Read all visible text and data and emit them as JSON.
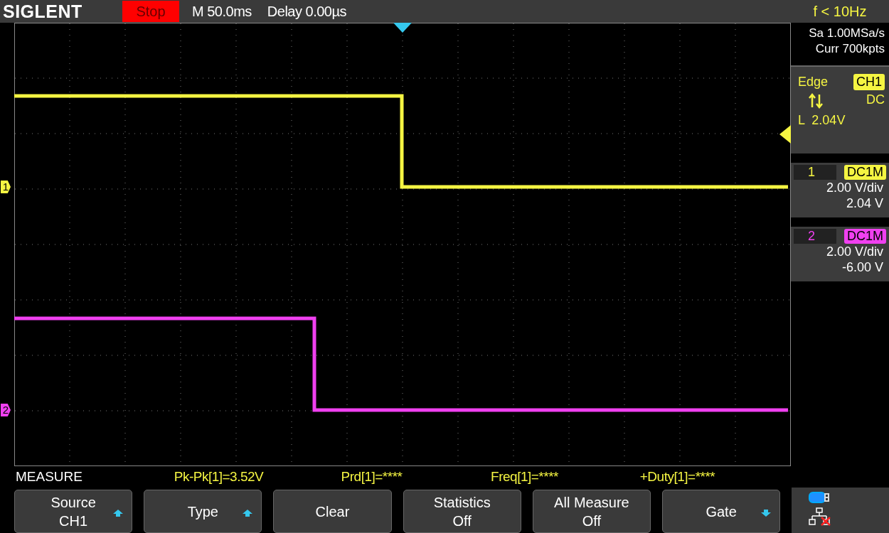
{
  "header": {
    "logo": "SIGLENT",
    "run_state": "Stop",
    "timebase": "M 50.0ms",
    "delay": "Delay 0.00µs",
    "frequency": "f < 10Hz"
  },
  "acquisition": {
    "sample_rate": "Sa 1.00MSa/s",
    "memory": "Curr 700kpts"
  },
  "trigger": {
    "type": "Edge",
    "source": "CH1",
    "coupling": "DC",
    "level": "L  2.04V"
  },
  "channels": [
    {
      "marker": "1",
      "number": "1",
      "coupling": "DC1M",
      "scale": "2.00 V/div",
      "offset": "2.04 V",
      "color": "#f5f542"
    },
    {
      "marker": "2",
      "number": "2",
      "coupling": "DC1M",
      "scale": "2.00 V/div",
      "offset": "-6.00 V",
      "color": "#f040f0"
    }
  ],
  "measure": {
    "title": "MEASURE",
    "readings": [
      "Pk-Pk[1]=3.52V",
      "Prd[1]=****",
      "Freq[1]=****",
      "+Duty[1]=****"
    ]
  },
  "softkeys": [
    {
      "kind": "uparrow",
      "label": "Source",
      "value": "CH1"
    },
    {
      "kind": "uparrow",
      "label": "Type"
    },
    {
      "kind": "plain",
      "label": "Clear"
    },
    {
      "kind": "plain",
      "label": "Statistics",
      "value": "Off"
    },
    {
      "kind": "plain",
      "label": "All Measure",
      "value": "Off"
    },
    {
      "kind": "downarrow",
      "label": "Gate"
    }
  ]
}
